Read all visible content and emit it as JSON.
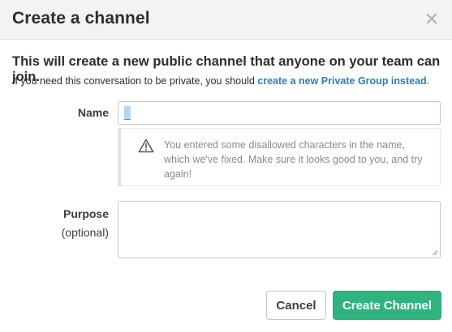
{
  "dialog": {
    "title": "Create a channel",
    "close_icon": "close-icon"
  },
  "intro": {
    "heading": "This will create a new public channel that anyone on your team can join.",
    "sub_prefix": "If you need this conversation to be private, you should ",
    "sub_link": "create a new Private Group instead",
    "sub_suffix": "."
  },
  "form": {
    "name_label": "Name",
    "name_value": "",
    "warning_icon": "warning-triangle-icon",
    "warning_text": "You entered some disallowed characters in the name, which we've fixed. Make sure it looks good to you, and try again!",
    "purpose_label": "Purpose",
    "purpose_optional": "(optional)",
    "purpose_value": ""
  },
  "actions": {
    "cancel_label": "Cancel",
    "create_label": "Create Channel"
  },
  "colors": {
    "primary_button": "#2fb480",
    "link": "#2a80b9",
    "header_bg": "#f3f3f3"
  }
}
